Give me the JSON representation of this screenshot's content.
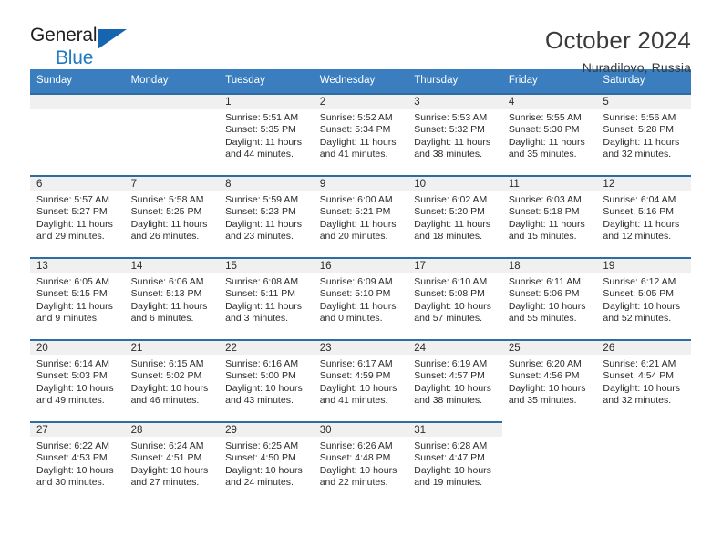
{
  "brand": {
    "name_part1": "General",
    "name_part2": "Blue",
    "logo_icon": "triangle-logo-icon"
  },
  "header": {
    "title": "October 2024",
    "location": "Nuradilovo, Russia"
  },
  "colors": {
    "header_blue": "#3a7ebf",
    "row_rule_blue": "#2e6da4",
    "date_band_gray": "#f0f0f0",
    "brand_blue": "#1f7ac4"
  },
  "weekdays": [
    "Sunday",
    "Monday",
    "Tuesday",
    "Wednesday",
    "Thursday",
    "Friday",
    "Saturday"
  ],
  "labels": {
    "sunrise_prefix": "Sunrise:",
    "sunset_prefix": "Sunset:",
    "daylight_prefix": "Daylight:"
  },
  "weeks": [
    [
      {
        "state": "empty-lead",
        "day": ""
      },
      {
        "state": "empty-lead",
        "day": ""
      },
      {
        "state": "filled",
        "day": "1",
        "sunrise": "Sunrise: 5:51 AM",
        "sunset": "Sunset: 5:35 PM",
        "daylight": "Daylight: 11 hours and 44 minutes."
      },
      {
        "state": "filled",
        "day": "2",
        "sunrise": "Sunrise: 5:52 AM",
        "sunset": "Sunset: 5:34 PM",
        "daylight": "Daylight: 11 hours and 41 minutes."
      },
      {
        "state": "filled",
        "day": "3",
        "sunrise": "Sunrise: 5:53 AM",
        "sunset": "Sunset: 5:32 PM",
        "daylight": "Daylight: 11 hours and 38 minutes."
      },
      {
        "state": "filled",
        "day": "4",
        "sunrise": "Sunrise: 5:55 AM",
        "sunset": "Sunset: 5:30 PM",
        "daylight": "Daylight: 11 hours and 35 minutes."
      },
      {
        "state": "filled",
        "day": "5",
        "sunrise": "Sunrise: 5:56 AM",
        "sunset": "Sunset: 5:28 PM",
        "daylight": "Daylight: 11 hours and 32 minutes."
      }
    ],
    [
      {
        "state": "filled",
        "day": "6",
        "sunrise": "Sunrise: 5:57 AM",
        "sunset": "Sunset: 5:27 PM",
        "daylight": "Daylight: 11 hours and 29 minutes."
      },
      {
        "state": "filled",
        "day": "7",
        "sunrise": "Sunrise: 5:58 AM",
        "sunset": "Sunset: 5:25 PM",
        "daylight": "Daylight: 11 hours and 26 minutes."
      },
      {
        "state": "filled",
        "day": "8",
        "sunrise": "Sunrise: 5:59 AM",
        "sunset": "Sunset: 5:23 PM",
        "daylight": "Daylight: 11 hours and 23 minutes."
      },
      {
        "state": "filled",
        "day": "9",
        "sunrise": "Sunrise: 6:00 AM",
        "sunset": "Sunset: 5:21 PM",
        "daylight": "Daylight: 11 hours and 20 minutes."
      },
      {
        "state": "filled",
        "day": "10",
        "sunrise": "Sunrise: 6:02 AM",
        "sunset": "Sunset: 5:20 PM",
        "daylight": "Daylight: 11 hours and 18 minutes."
      },
      {
        "state": "filled",
        "day": "11",
        "sunrise": "Sunrise: 6:03 AM",
        "sunset": "Sunset: 5:18 PM",
        "daylight": "Daylight: 11 hours and 15 minutes."
      },
      {
        "state": "filled",
        "day": "12",
        "sunrise": "Sunrise: 6:04 AM",
        "sunset": "Sunset: 5:16 PM",
        "daylight": "Daylight: 11 hours and 12 minutes."
      }
    ],
    [
      {
        "state": "filled",
        "day": "13",
        "sunrise": "Sunrise: 6:05 AM",
        "sunset": "Sunset: 5:15 PM",
        "daylight": "Daylight: 11 hours and 9 minutes."
      },
      {
        "state": "filled",
        "day": "14",
        "sunrise": "Sunrise: 6:06 AM",
        "sunset": "Sunset: 5:13 PM",
        "daylight": "Daylight: 11 hours and 6 minutes."
      },
      {
        "state": "filled",
        "day": "15",
        "sunrise": "Sunrise: 6:08 AM",
        "sunset": "Sunset: 5:11 PM",
        "daylight": "Daylight: 11 hours and 3 minutes."
      },
      {
        "state": "filled",
        "day": "16",
        "sunrise": "Sunrise: 6:09 AM",
        "sunset": "Sunset: 5:10 PM",
        "daylight": "Daylight: 11 hours and 0 minutes."
      },
      {
        "state": "filled",
        "day": "17",
        "sunrise": "Sunrise: 6:10 AM",
        "sunset": "Sunset: 5:08 PM",
        "daylight": "Daylight: 10 hours and 57 minutes."
      },
      {
        "state": "filled",
        "day": "18",
        "sunrise": "Sunrise: 6:11 AM",
        "sunset": "Sunset: 5:06 PM",
        "daylight": "Daylight: 10 hours and 55 minutes."
      },
      {
        "state": "filled",
        "day": "19",
        "sunrise": "Sunrise: 6:12 AM",
        "sunset": "Sunset: 5:05 PM",
        "daylight": "Daylight: 10 hours and 52 minutes."
      }
    ],
    [
      {
        "state": "filled",
        "day": "20",
        "sunrise": "Sunrise: 6:14 AM",
        "sunset": "Sunset: 5:03 PM",
        "daylight": "Daylight: 10 hours and 49 minutes."
      },
      {
        "state": "filled",
        "day": "21",
        "sunrise": "Sunrise: 6:15 AM",
        "sunset": "Sunset: 5:02 PM",
        "daylight": "Daylight: 10 hours and 46 minutes."
      },
      {
        "state": "filled",
        "day": "22",
        "sunrise": "Sunrise: 6:16 AM",
        "sunset": "Sunset: 5:00 PM",
        "daylight": "Daylight: 10 hours and 43 minutes."
      },
      {
        "state": "filled",
        "day": "23",
        "sunrise": "Sunrise: 6:17 AM",
        "sunset": "Sunset: 4:59 PM",
        "daylight": "Daylight: 10 hours and 41 minutes."
      },
      {
        "state": "filled",
        "day": "24",
        "sunrise": "Sunrise: 6:19 AM",
        "sunset": "Sunset: 4:57 PM",
        "daylight": "Daylight: 10 hours and 38 minutes."
      },
      {
        "state": "filled",
        "day": "25",
        "sunrise": "Sunrise: 6:20 AM",
        "sunset": "Sunset: 4:56 PM",
        "daylight": "Daylight: 10 hours and 35 minutes."
      },
      {
        "state": "filled",
        "day": "26",
        "sunrise": "Sunrise: 6:21 AM",
        "sunset": "Sunset: 4:54 PM",
        "daylight": "Daylight: 10 hours and 32 minutes."
      }
    ],
    [
      {
        "state": "filled",
        "day": "27",
        "sunrise": "Sunrise: 6:22 AM",
        "sunset": "Sunset: 4:53 PM",
        "daylight": "Daylight: 10 hours and 30 minutes."
      },
      {
        "state": "filled",
        "day": "28",
        "sunrise": "Sunrise: 6:24 AM",
        "sunset": "Sunset: 4:51 PM",
        "daylight": "Daylight: 10 hours and 27 minutes."
      },
      {
        "state": "filled",
        "day": "29",
        "sunrise": "Sunrise: 6:25 AM",
        "sunset": "Sunset: 4:50 PM",
        "daylight": "Daylight: 10 hours and 24 minutes."
      },
      {
        "state": "filled",
        "day": "30",
        "sunrise": "Sunrise: 6:26 AM",
        "sunset": "Sunset: 4:48 PM",
        "daylight": "Daylight: 10 hours and 22 minutes."
      },
      {
        "state": "filled",
        "day": "31",
        "sunrise": "Sunrise: 6:28 AM",
        "sunset": "Sunset: 4:47 PM",
        "daylight": "Daylight: 10 hours and 19 minutes."
      },
      {
        "state": "blank",
        "day": ""
      },
      {
        "state": "blank",
        "day": ""
      }
    ]
  ]
}
